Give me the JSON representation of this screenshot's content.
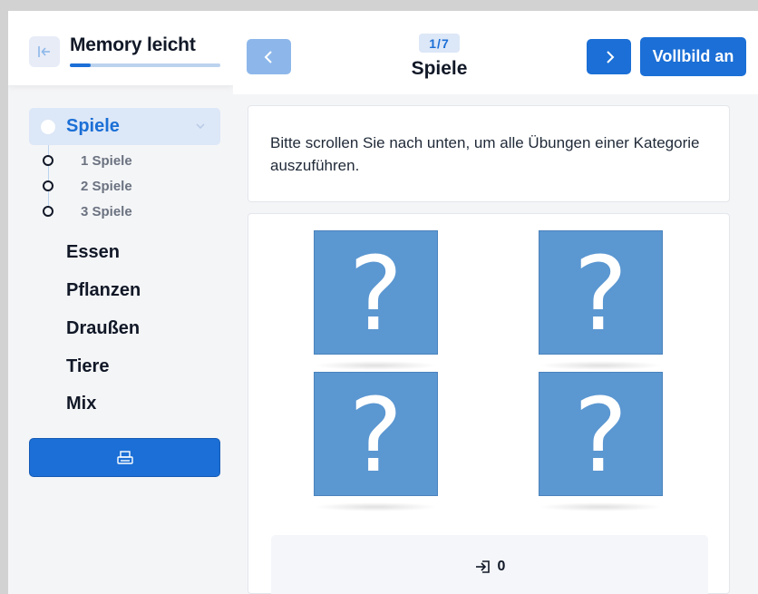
{
  "sidebar": {
    "title": "Memory leicht",
    "progress": 0.14,
    "active_section": "Spiele",
    "sub_items": [
      "1 Spiele",
      "2 Spiele",
      "3 Spiele"
    ],
    "categories": [
      "Essen",
      "Pflanzen",
      "Draußen",
      "Tiere",
      "Mix"
    ],
    "icons": {
      "collapse": "collapse-sidebar-icon",
      "chevron": "chevron-down-icon",
      "print": "print-icon"
    }
  },
  "header": {
    "counter": "1/7",
    "title": "Spiele",
    "fullscreen_label": "Vollbild an",
    "icons": {
      "prev": "chevron-left-icon",
      "next": "chevron-right-icon"
    }
  },
  "main": {
    "info_text": "Bitte scrollen Sie nach unten, um alle Übungen einer Kategorie auszuführen.",
    "card_symbol": "?",
    "cards": [
      "?",
      "?",
      "?",
      "?"
    ],
    "score": {
      "icon": "login-icon",
      "value": "0"
    }
  },
  "colors": {
    "accent": "#1b6fd6",
    "accent_light": "#8db7ea",
    "card": "#5b97d1",
    "active_bg": "#dce7f7"
  }
}
